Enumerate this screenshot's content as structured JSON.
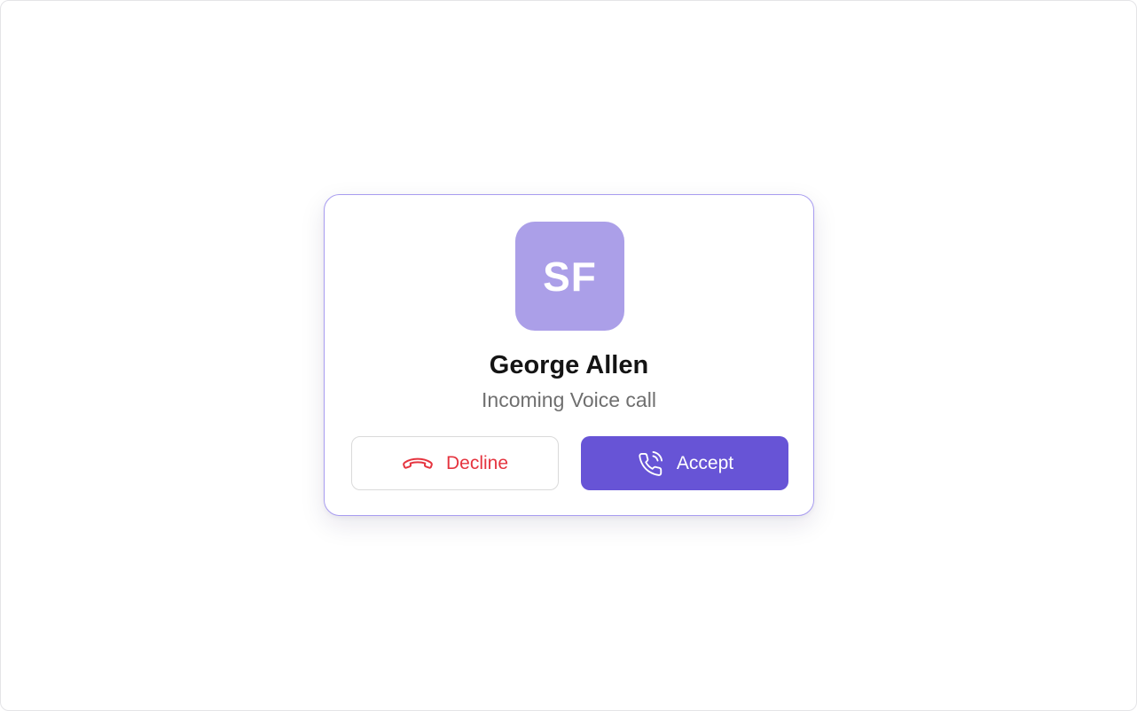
{
  "call": {
    "avatar_initials": "SF",
    "caller_name": "George Allen",
    "status": "Incoming Voice call"
  },
  "actions": {
    "decline": {
      "label": "Decline",
      "icon": "phone-hangup-icon"
    },
    "accept": {
      "label": "Accept",
      "icon": "phone-incoming-icon"
    }
  },
  "colors": {
    "avatar_bg": "#ab9fe8",
    "accent": "#6754d6",
    "decline_red": "#e5343f",
    "card_border": "#a89cf0"
  }
}
